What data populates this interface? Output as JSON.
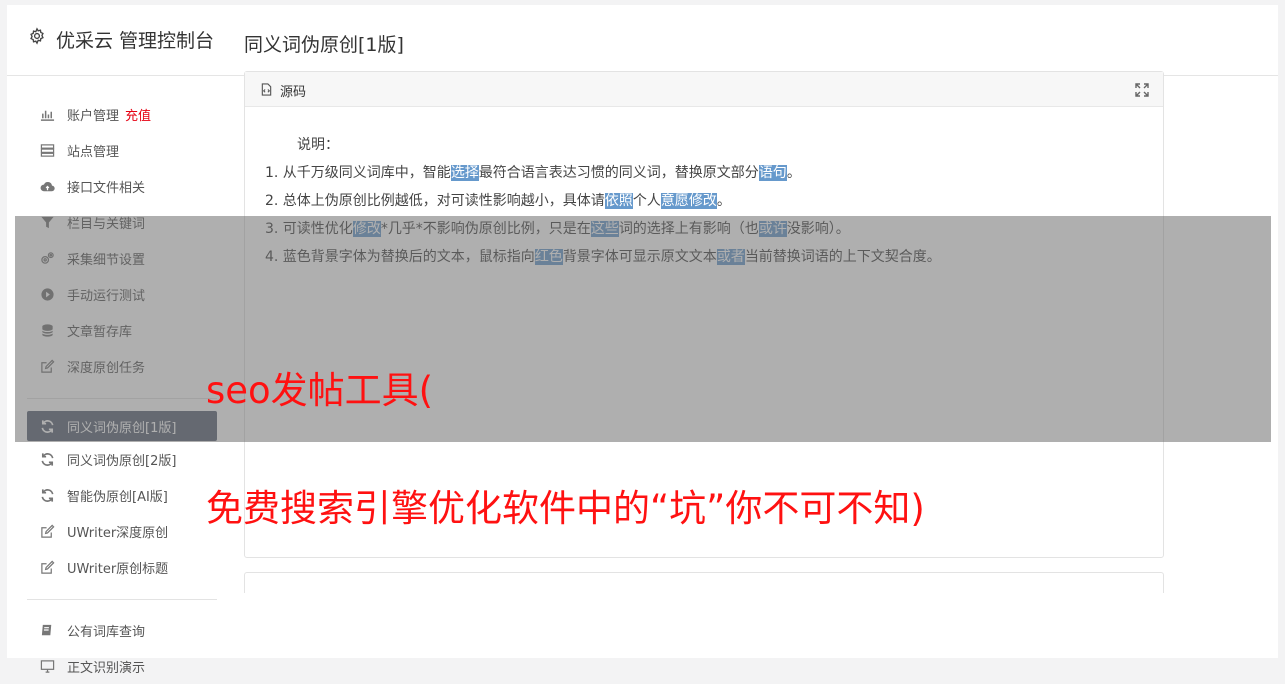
{
  "header": {
    "title": "优采云 管理控制台"
  },
  "sidebar": {
    "group1": [
      {
        "label": "账户管理",
        "extra": "充值",
        "icon": "bar-chart-icon"
      },
      {
        "label": "站点管理",
        "icon": "server-icon"
      },
      {
        "label": "接口文件相关",
        "icon": "cloud-upload-icon"
      },
      {
        "label": "栏目与关键词",
        "icon": "filter-icon"
      },
      {
        "label": "采集细节设置",
        "icon": "gears-icon"
      },
      {
        "label": "手动运行测试",
        "icon": "play-circle-icon"
      },
      {
        "label": "文章暂存库",
        "icon": "database-icon"
      },
      {
        "label": "深度原创任务",
        "icon": "edit-icon"
      }
    ],
    "group2": [
      {
        "label": "同义词伪原创[1版]",
        "icon": "refresh-icon",
        "active": true
      },
      {
        "label": "同义词伪原创[2版]",
        "icon": "refresh-icon"
      },
      {
        "label": "智能伪原创[AI版]",
        "icon": "refresh-icon"
      },
      {
        "label": "UWriter深度原创",
        "icon": "edit-icon"
      },
      {
        "label": "UWriter原创标题",
        "icon": "edit-icon"
      }
    ],
    "group3": [
      {
        "label": "公有词库查询",
        "icon": "book-icon"
      },
      {
        "label": "正文识别演示",
        "icon": "desktop-icon"
      }
    ]
  },
  "main": {
    "title": "同义词伪原创[1版]",
    "panel_label": "源码",
    "desc_title": "说明：",
    "lines": [
      [
        "1. 从千万级同义词库中，智能",
        {
          "hl": "选择"
        },
        "最符合语言表达习惯的同义词，替换原文部分",
        {
          "hl": "语句"
        },
        "。"
      ],
      [
        "2. 总体上伪原创比例越低，对可读性影响越小，具体请",
        {
          "hl": "依照"
        },
        "个人",
        {
          "hl": "意愿"
        },
        {
          "hl": "修改"
        },
        "。"
      ],
      [
        "3. 可读性优化",
        {
          "hl": "修改"
        },
        "*几乎*不影响伪原创比例，只是在",
        {
          "hl": "这些"
        },
        "词的选择上有影响（也",
        {
          "hl": "或许"
        },
        "没影响）。"
      ],
      [
        "4. 蓝色背景字体为替换后的文本，鼠标指向",
        {
          "hl": "红色"
        },
        "背景字体可显示原文文本",
        {
          "hl": "或者"
        },
        "当前替换词语的上下文契合度。"
      ]
    ]
  },
  "overlay": {
    "line1": "seo发帖工具(",
    "line2": "免费搜索引擎优化软件中的“坑”你不可不知)"
  },
  "colors": {
    "highlight": "#6699cc",
    "overlay_text": "#ff1111",
    "active_nav": "#5b6577",
    "recharge": "#e60012"
  }
}
